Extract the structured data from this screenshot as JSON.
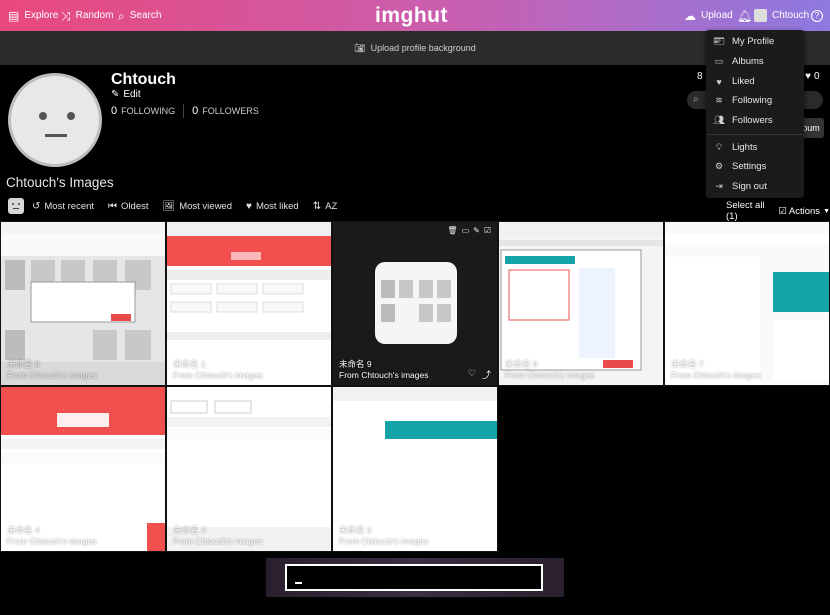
{
  "topbar": {
    "explore": "Explore",
    "random": "Random",
    "search": "Search",
    "logo": "imghut",
    "upload": "Upload",
    "user": "Chtouch"
  },
  "profile_bg": {
    "label": "Upload profile background"
  },
  "profile": {
    "name": "Chtouch",
    "edit": "Edit",
    "following_count": "0",
    "following_label": "FOLLOWING",
    "followers_count": "0",
    "followers_label": "FOLLOWERS",
    "right_count_a": "8",
    "right_count_b": "0"
  },
  "images_title": "Chtouch's Images",
  "toolbar": {
    "most_recent": "Most recent",
    "oldest": "Oldest",
    "most_viewed": "Most viewed",
    "most_liked": "Most liked",
    "az": "AZ",
    "select_all": "Select all (1)",
    "actions": "Actions"
  },
  "dropdown": {
    "items": [
      "My Profile",
      "Albums",
      "Liked",
      "Following",
      "Followers",
      "Lights",
      "Settings",
      "Sign out"
    ]
  },
  "tiles": [
    {
      "title": "未命名 8",
      "from": "From Chtouch's images"
    },
    {
      "title": "未命名 1",
      "from": "From Chtouch's images"
    },
    {
      "title": "未命名 9",
      "from": "From Chtouch's images"
    },
    {
      "title": "未命名 6",
      "from": "From Chtouch's images"
    },
    {
      "title": "未命名 7",
      "from": "From Chtouch's images"
    },
    {
      "title": "未命名 4",
      "from": "From Chtouch's images"
    },
    {
      "title": "未命名 3",
      "from": "From Chtouch's images"
    },
    {
      "title": "未命名 5",
      "from": "From Chtouch's images"
    }
  ],
  "right_button": "Album",
  "colors": {
    "top_left": "#e9487d",
    "top_right": "#8d79e0",
    "accent_red": "#f0534f"
  }
}
